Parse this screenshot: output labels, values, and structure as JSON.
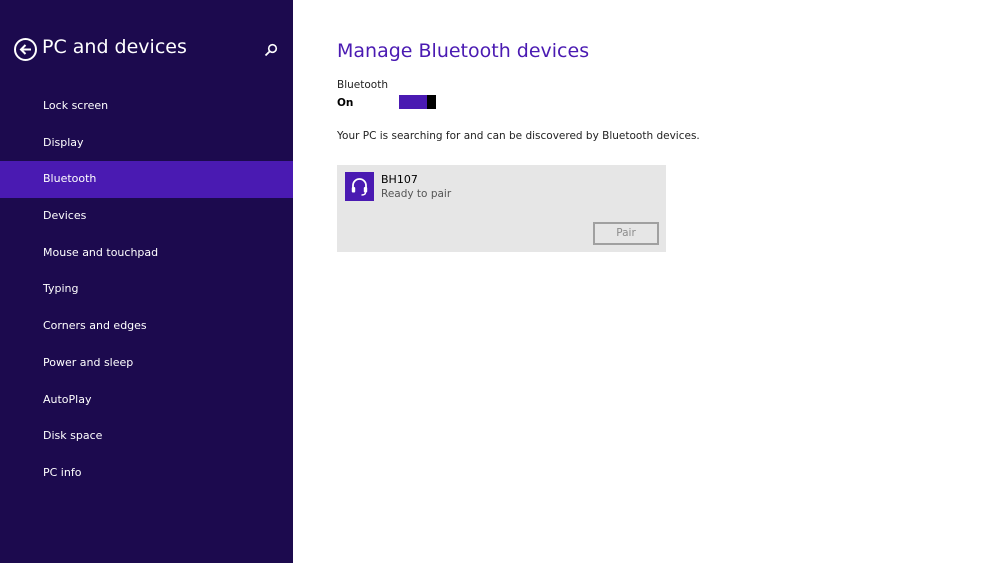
{
  "sidebar": {
    "title": "PC and devices",
    "back_icon": "back-arrow-icon",
    "search_icon": "search-icon",
    "items": [
      {
        "label": "Lock screen"
      },
      {
        "label": "Display"
      },
      {
        "label": "Bluetooth",
        "active": true
      },
      {
        "label": "Devices"
      },
      {
        "label": "Mouse and touchpad"
      },
      {
        "label": "Typing"
      },
      {
        "label": "Corners and edges"
      },
      {
        "label": "Power and sleep"
      },
      {
        "label": "AutoPlay"
      },
      {
        "label": "Disk space"
      },
      {
        "label": "PC info"
      }
    ]
  },
  "main": {
    "title": "Manage Bluetooth devices",
    "bluetooth_label": "Bluetooth",
    "bluetooth_state": "On",
    "toggle_on": true,
    "info_text": "Your PC is searching for and can be discovered by Bluetooth devices.",
    "devices": [
      {
        "name": "BH107",
        "status": "Ready to pair",
        "icon": "headset-icon",
        "button_label": "Pair"
      }
    ]
  },
  "colors": {
    "sidebar_bg": "#1c0a4e",
    "accent": "#4a1ab2",
    "card_bg": "#e6e6e6"
  }
}
